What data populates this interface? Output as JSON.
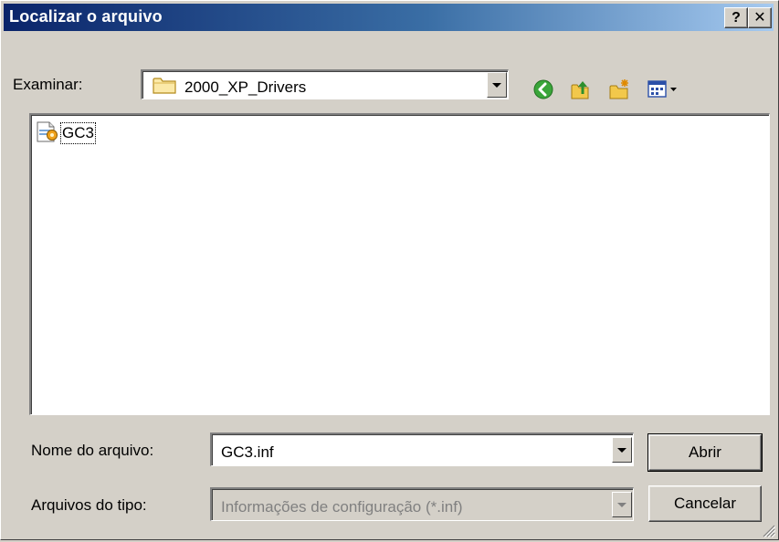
{
  "window": {
    "title": "Localizar o arquivo",
    "help_label": "?",
    "close_label": "✕"
  },
  "look_in": {
    "label": "Examinar:",
    "value": "2000_XP_Drivers",
    "icon": "folder-icon"
  },
  "toolbar": {
    "back_icon": "back-arrow-icon",
    "up_icon": "up-folder-icon",
    "new_folder_icon": "new-folder-icon",
    "view_icon": "view-menu-icon"
  },
  "files": [
    {
      "name": "GC3",
      "icon": "setup-information-file-icon"
    }
  ],
  "filename": {
    "label": "Nome do arquivo:",
    "value": "GC3.inf"
  },
  "filetype": {
    "label": "Arquivos do tipo:",
    "value": "Informações de configuração (*.inf)"
  },
  "buttons": {
    "open_label": "Abrir",
    "cancel_label": "Cancelar"
  },
  "colors": {
    "title_gradient_start": "#0a246a",
    "title_gradient_end": "#a6caf0",
    "face": "#d4d0c8"
  }
}
